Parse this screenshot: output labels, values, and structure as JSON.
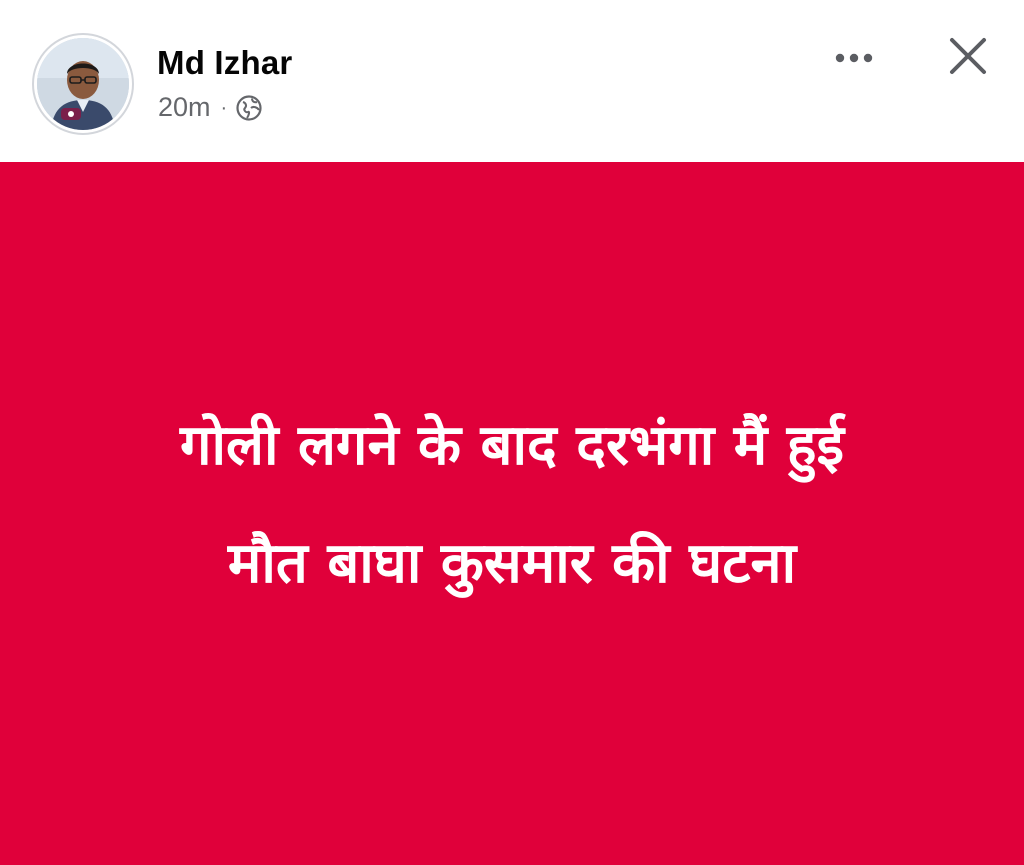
{
  "post": {
    "author_name": "Md Izhar",
    "timestamp": "20m",
    "separator": "·",
    "privacy_icon": "globe-icon",
    "more_icon": "more-options-icon",
    "close_icon": "close-icon",
    "background_color": "#E0003A",
    "text_color": "#FFFFFF",
    "text_line_1": "गोली लगने के बाद दरभंगा मैं हुई",
    "text_line_2": "मौत बाघा कुसमार की घटना"
  }
}
